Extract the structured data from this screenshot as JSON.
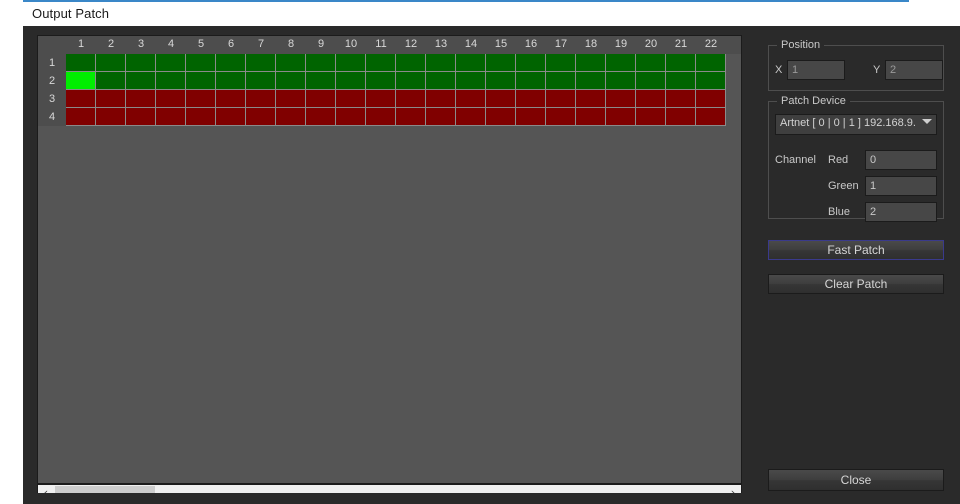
{
  "window": {
    "title": "Output Patch",
    "close_glyph": "✖",
    "accent_color": "#3a87c8"
  },
  "grid": {
    "columns": [
      1,
      2,
      3,
      4,
      5,
      6,
      7,
      8,
      9,
      10,
      11,
      12,
      13,
      14,
      15,
      16,
      17,
      18,
      19,
      20,
      21,
      22
    ],
    "rows": [
      1,
      2,
      3,
      4
    ],
    "colors": {
      "patched_green": "#006400",
      "selected_green": "#00ee00",
      "unpatched_red": "#800000",
      "grid_line": "#8a8a8a",
      "canvas": "#555555",
      "header": "#4d4d4d"
    },
    "cell_states": [
      [
        "patched",
        "patched",
        "patched",
        "patched",
        "patched",
        "patched",
        "patched",
        "patched",
        "patched",
        "patched",
        "patched",
        "patched",
        "patched",
        "patched",
        "patched",
        "patched",
        "patched",
        "patched",
        "patched",
        "patched",
        "patched",
        "patched"
      ],
      [
        "selected",
        "patched",
        "patched",
        "patched",
        "patched",
        "patched",
        "patched",
        "patched",
        "patched",
        "patched",
        "patched",
        "patched",
        "patched",
        "patched",
        "patched",
        "patched",
        "patched",
        "patched",
        "patched",
        "patched",
        "patched",
        "patched"
      ],
      [
        "unpatched",
        "unpatched",
        "unpatched",
        "unpatched",
        "unpatched",
        "unpatched",
        "unpatched",
        "unpatched",
        "unpatched",
        "unpatched",
        "unpatched",
        "unpatched",
        "unpatched",
        "unpatched",
        "unpatched",
        "unpatched",
        "unpatched",
        "unpatched",
        "unpatched",
        "unpatched",
        "unpatched",
        "unpatched"
      ],
      [
        "unpatched",
        "unpatched",
        "unpatched",
        "unpatched",
        "unpatched",
        "unpatched",
        "unpatched",
        "unpatched",
        "unpatched",
        "unpatched",
        "unpatched",
        "unpatched",
        "unpatched",
        "unpatched",
        "unpatched",
        "unpatched",
        "unpatched",
        "unpatched",
        "unpatched",
        "unpatched",
        "unpatched",
        "unpatched"
      ]
    ]
  },
  "scrollbar": {
    "left_glyph": "‹",
    "right_glyph": "›"
  },
  "position": {
    "group_title": "Position",
    "x_label": "X",
    "x_value": "1",
    "y_label": "Y",
    "y_value": "2"
  },
  "patch_device": {
    "group_title": "Patch Device",
    "device_value": "Artnet [ 0 | 0 | 1 ] 192.168.9.",
    "channel_label": "Channel",
    "red_label": "Red",
    "red_value": "0",
    "green_label": "Green",
    "green_value": "1",
    "blue_label": "Blue",
    "blue_value": "2"
  },
  "buttons": {
    "fast_patch": "Fast Patch",
    "clear_patch": "Clear Patch",
    "close": "Close"
  }
}
